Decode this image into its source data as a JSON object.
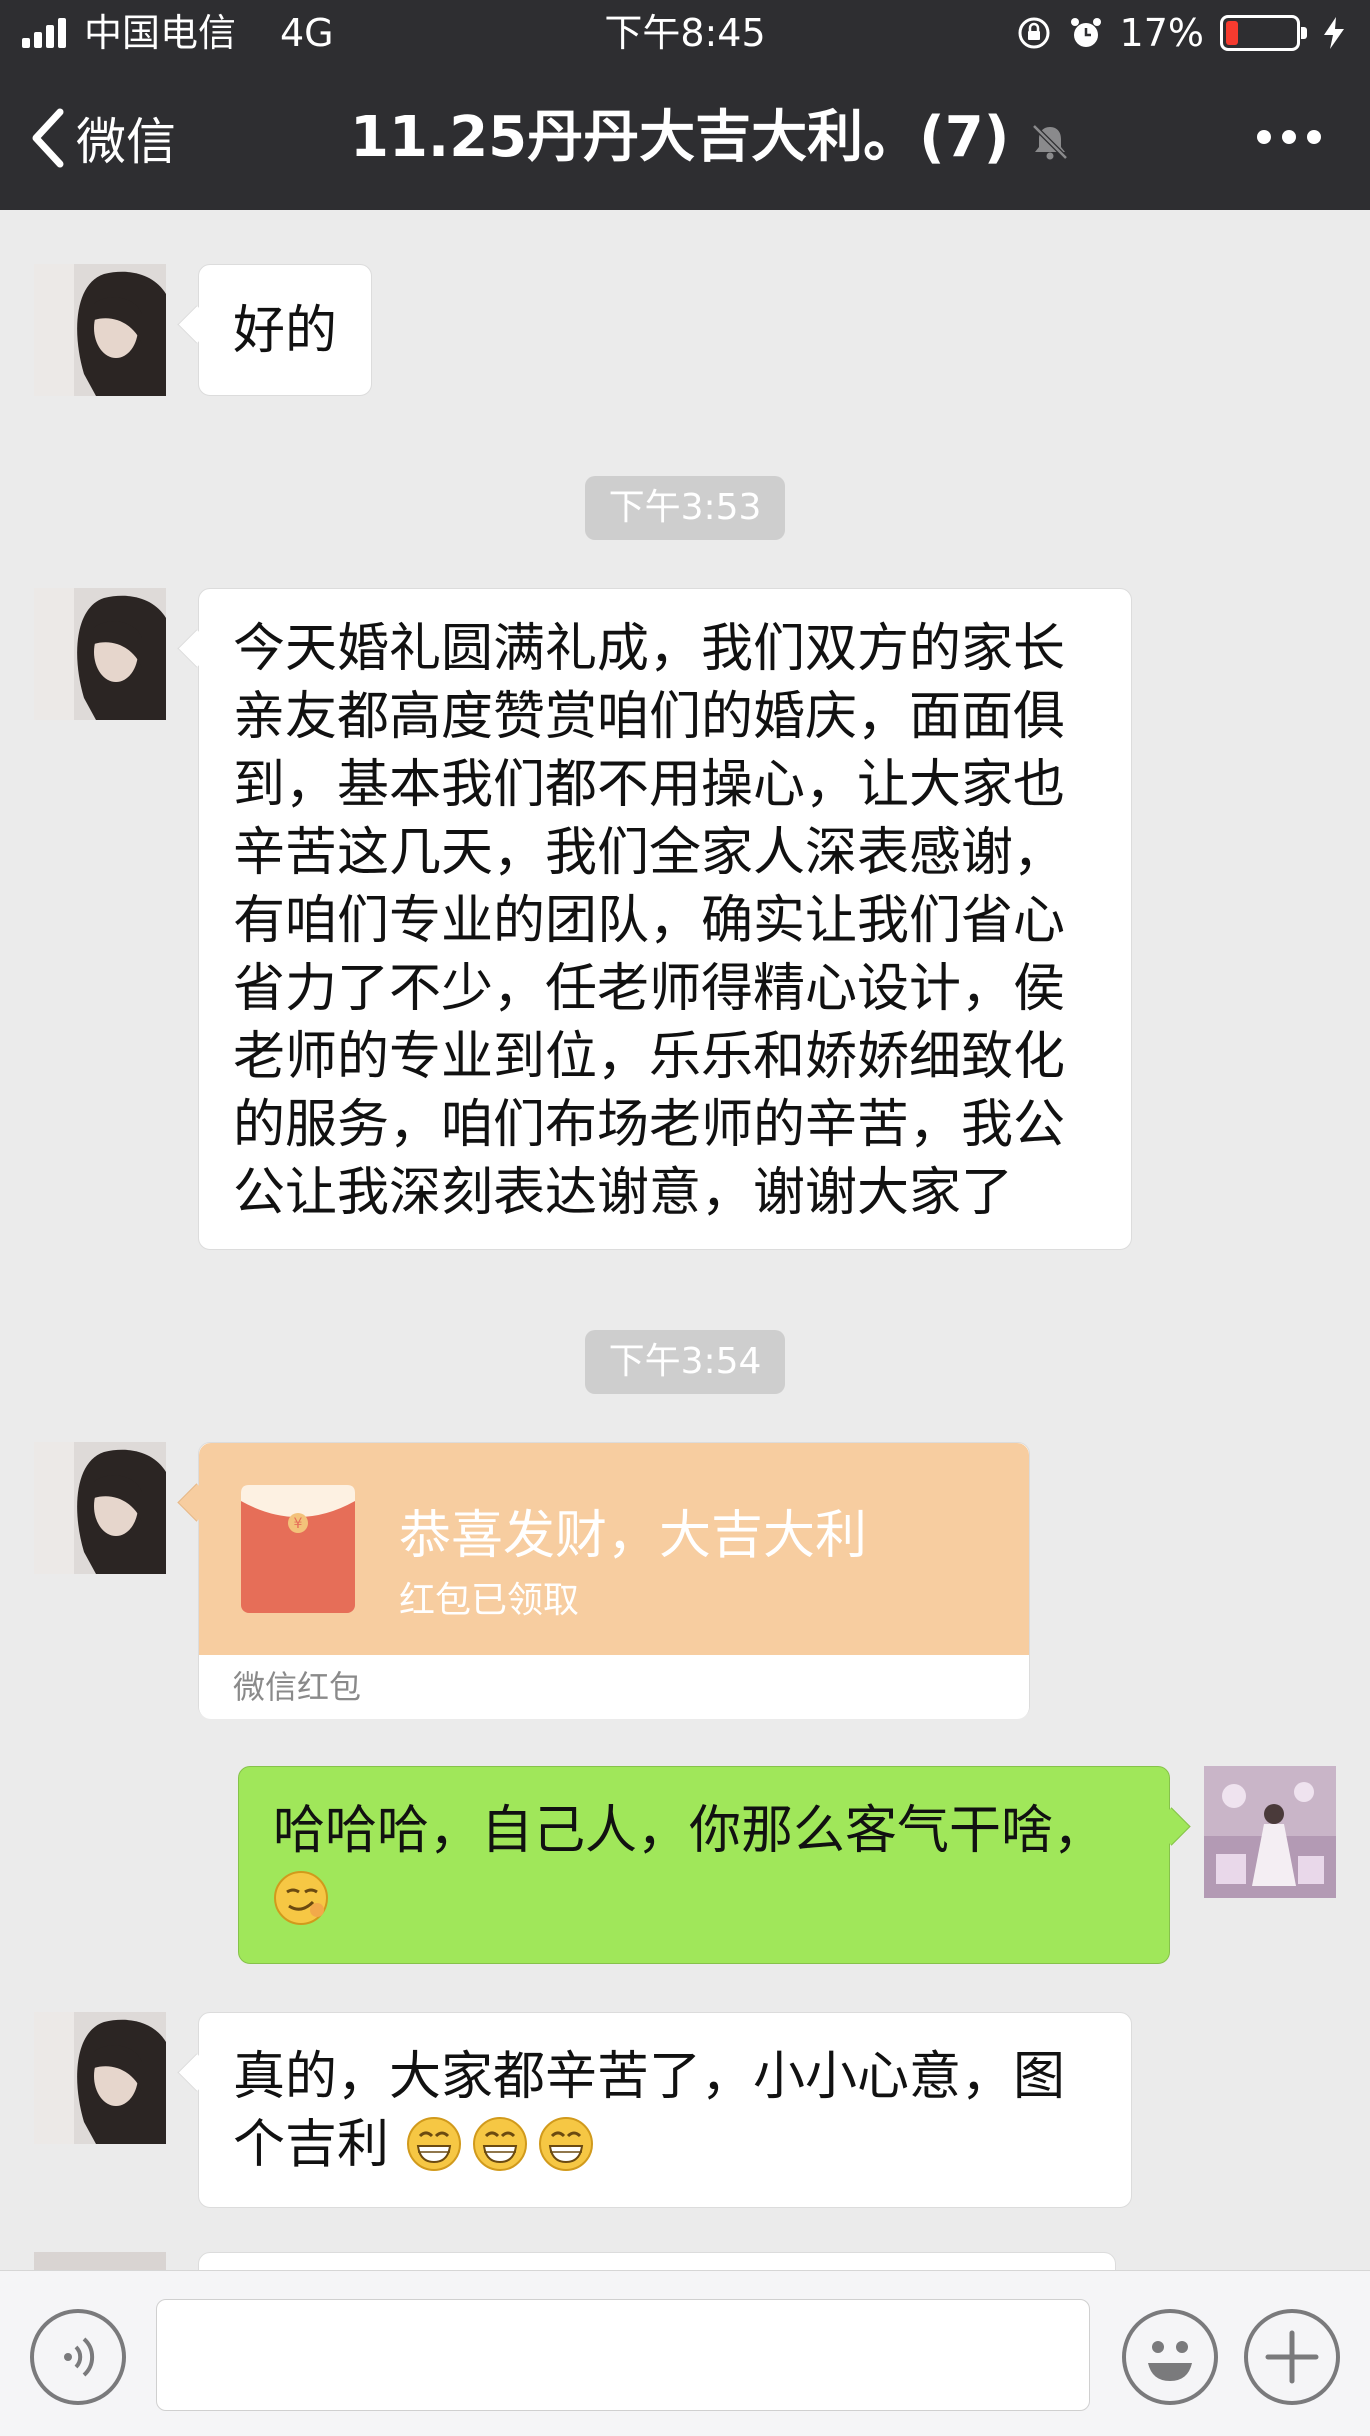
{
  "status_bar": {
    "carrier": "中国电信",
    "network": "4G",
    "time": "下午8:45",
    "battery": "17%",
    "battery_level": 0.17
  },
  "nav": {
    "back_label": "微信",
    "title": "11.25丹丹大吉大利。(7)",
    "muted": true
  },
  "messages": [
    {
      "side": "left",
      "text": "好的"
    },
    {
      "type": "timestamp",
      "text": "下午3:53"
    },
    {
      "side": "left",
      "lines": [
        "今天婚礼圆满礼成，我们双方的家长",
        "亲友都高度赞赏咱们的婚庆，面面俱",
        "到，基本我们都不用操心，让大家也",
        "辛苦这几天，我们全家人深表感谢，",
        "有咱们专业的团队，确实让我们省心",
        "省力了不少，任老师得精心设计，侯",
        "老师的专业到位，乐乐和娇娇细致化",
        "的服务，咱们布场老师的辛苦，我公",
        "公让我深刻表达谢意，谢谢大家了"
      ]
    },
    {
      "type": "timestamp",
      "text": "下午3:54"
    },
    {
      "side": "left",
      "type": "red_packet",
      "title": "恭喜发财，大吉大利",
      "status": "红包已领取",
      "footer": "微信红包"
    },
    {
      "side": "right",
      "lines": [
        "哈哈哈，自己人，你那么客气干啥，"
      ],
      "emoji": "smirk-emoji"
    },
    {
      "side": "left",
      "lines": [
        "真的，大家都辛苦了，小小心意，图",
        "个吉利"
      ],
      "emojis": [
        "grin-emoji",
        "grin-emoji",
        "grin-emoji"
      ]
    }
  ],
  "input_bar": {
    "voice_icon": "voice-icon",
    "emoji_icon": "emoji-icon",
    "plus_icon": "plus-icon",
    "value": ""
  },
  "colors": {
    "nav_bg": "#2e2e31",
    "chat_bg": "#ebebeb",
    "my_bubble": "#a0e75a",
    "red_packet": "#f7cda0",
    "battery_low": "#f53b2f"
  }
}
